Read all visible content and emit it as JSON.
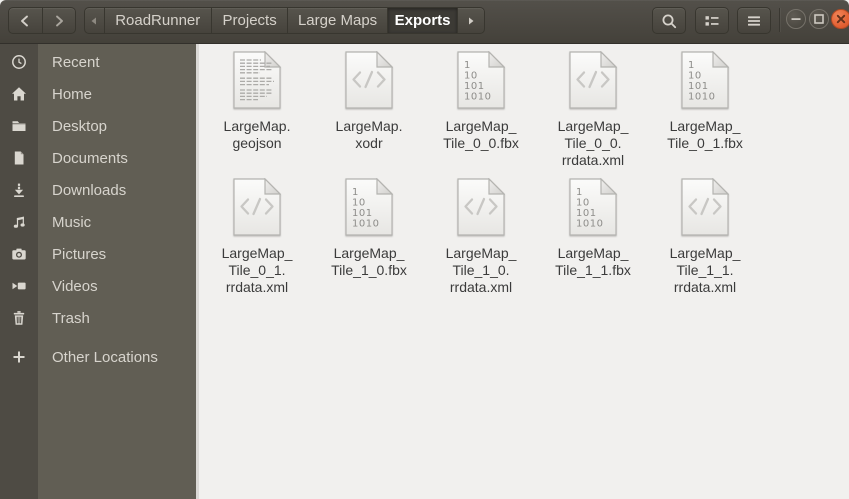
{
  "titlebar": {
    "breadcrumbs": {
      "items": [
        {
          "label": "RoadRunner",
          "active": false
        },
        {
          "label": "Projects",
          "active": false
        },
        {
          "label": "Large Maps",
          "active": false
        },
        {
          "label": "Exports",
          "active": true
        }
      ]
    }
  },
  "icons": {
    "toolbar": [
      "back-icon",
      "forward-icon",
      "breadcrumb-scroll-left-icon",
      "breadcrumb-scroll-right-icon",
      "search-icon",
      "list-view-icon",
      "menu-icon"
    ],
    "window_controls": [
      "minimize-icon",
      "maximize-icon",
      "close-icon"
    ],
    "sidebar": [
      "clock-icon",
      "home-icon",
      "folder-icon",
      "document-icon",
      "download-icon",
      "music-notes-icon",
      "camera-icon",
      "video-camera-icon",
      "trash-icon",
      "plus-icon"
    ],
    "file_kinds": {
      "text": "text-document-icon",
      "xml": "xml-code-icon",
      "fbx": "binary-data-icon"
    },
    "fbx_lines": [
      "1",
      "10",
      "101",
      "1010"
    ]
  },
  "sidebar": {
    "items": [
      {
        "label": "Recent",
        "icon": "clock-icon"
      },
      {
        "label": "Home",
        "icon": "home-icon"
      },
      {
        "label": "Desktop",
        "icon": "folder-icon"
      },
      {
        "label": "Documents",
        "icon": "document-icon"
      },
      {
        "label": "Downloads",
        "icon": "download-icon"
      },
      {
        "label": "Music",
        "icon": "music-notes-icon"
      },
      {
        "label": "Pictures",
        "icon": "camera-icon"
      },
      {
        "label": "Videos",
        "icon": "video-camera-icon"
      },
      {
        "label": "Trash",
        "icon": "trash-icon"
      },
      {
        "label": "Other Locations",
        "icon": "plus-icon"
      }
    ]
  },
  "files": {
    "items": [
      {
        "name": "LargeMap.geojson",
        "label": "LargeMap.\ngeojson",
        "kind": "text"
      },
      {
        "name": "LargeMap.xodr",
        "label": "LargeMap.\nxodr",
        "kind": "xml"
      },
      {
        "name": "LargeMap_Tile_0_0.fbx",
        "label": "LargeMap_\nTile_0_0.fbx",
        "kind": "fbx"
      },
      {
        "name": "LargeMap_Tile_0_0.rrdata.xml",
        "label": "LargeMap_\nTile_0_0.\nrrdata.xml",
        "kind": "xml"
      },
      {
        "name": "LargeMap_Tile_0_1.fbx",
        "label": "LargeMap_\nTile_0_1.fbx",
        "kind": "fbx"
      },
      {
        "name": "LargeMap_Tile_0_1.rrdata.xml",
        "label": "LargeMap_\nTile_0_1.\nrrdata.xml",
        "kind": "xml"
      },
      {
        "name": "LargeMap_Tile_1_0.fbx",
        "label": "LargeMap_\nTile_1_0.fbx",
        "kind": "fbx"
      },
      {
        "name": "LargeMap_Tile_1_0.rrdata.xml",
        "label": "LargeMap_\nTile_1_0.\nrrdata.xml",
        "kind": "xml"
      },
      {
        "name": "LargeMap_Tile_1_1.fbx",
        "label": "LargeMap_\nTile_1_1.fbx",
        "kind": "fbx"
      },
      {
        "name": "LargeMap_Tile_1_1.rrdata.xml",
        "label": "LargeMap_\nTile_1_1.\nrrdata.xml",
        "kind": "xml"
      }
    ]
  },
  "colors": {
    "toolbar": "#4c4943",
    "sidebar_icon_strip": "#4e4b44",
    "sidebar": "#615e54",
    "content_bg": "#f1f0ee",
    "file_label_text": "#3b3b3b",
    "close_button": "#e0602f"
  }
}
